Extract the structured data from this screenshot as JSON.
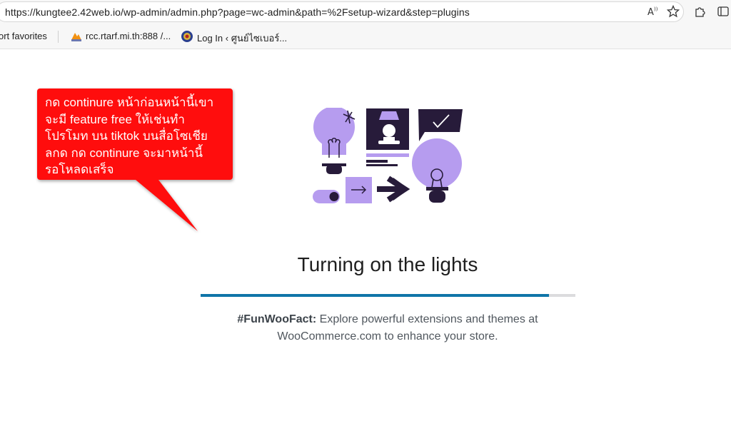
{
  "browser": {
    "url": "https://kungtee2.42web.io/wp-admin/admin.php?page=wc-admin&path=%2Fsetup-wizard&step=plugins",
    "favorites": [
      {
        "label": "ort favorites"
      },
      {
        "label": "rcc.rtarf.mi.th:888 /..."
      },
      {
        "label": "Log In ‹ ศูนย์ไซเบอร์..."
      }
    ]
  },
  "main": {
    "heading": "Turning on the lights",
    "progress_percent": 93,
    "fact_label": "#FunWooFact:",
    "fact_line1": " Explore powerful extensions and themes at",
    "fact_line2": "WooCommerce.com to enhance your store."
  },
  "annotation": {
    "lines": [
      "กด continure หน้าก่อนหน้านี้เขา",
      "จะมี feature free ให้เช่นทำ",
      "โปรโมท บน tiktok บนสื่อโซเชีย",
      "ลกด กด continure จะมาหน้านี้",
      "รอโหลดเสร็จ"
    ],
    "color": "#ff0d0d"
  },
  "colors": {
    "illustration_purple": "#b69cef",
    "illustration_dark": "#271b3a",
    "progress": "#0f75a8"
  }
}
